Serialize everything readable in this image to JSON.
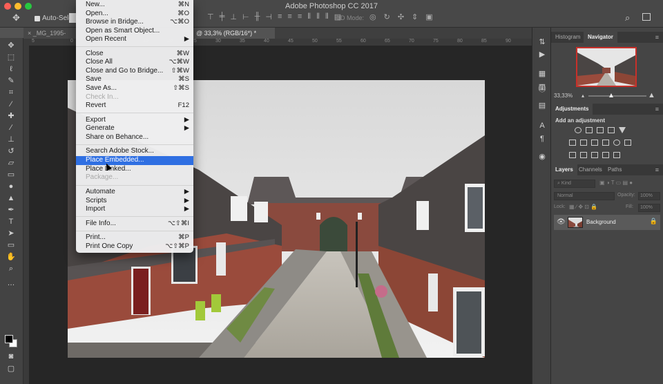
{
  "window": {
    "title": "Adobe Photoshop CC 2017"
  },
  "options_bar": {
    "auto_select_label": "Auto-Select:",
    "mode3d_label": "3D Mode:"
  },
  "doc_tabs": [
    {
      "label": "_MG_1995-bewe"
    },
    {
      "label": "@ 33,3% (RGB/16*) *"
    }
  ],
  "ruler_ticks": [
    "5",
    "0",
    "5",
    "10",
    "15",
    "20",
    "25",
    "30",
    "35",
    "40",
    "45",
    "50",
    "55",
    "60",
    "65",
    "70",
    "75",
    "80",
    "85",
    "90"
  ],
  "file_menu": {
    "items": [
      {
        "label": "New...",
        "shortcut": "⌘N",
        "state": "normal"
      },
      {
        "label": "Open...",
        "shortcut": "⌘O",
        "state": "normal"
      },
      {
        "label": "Browse in Bridge...",
        "shortcut": "⌥⌘O",
        "state": "normal"
      },
      {
        "label": "Open as Smart Object...",
        "shortcut": "",
        "state": "normal"
      },
      {
        "label": "Open Recent",
        "shortcut": "▶",
        "state": "normal"
      },
      {
        "label": "Close",
        "shortcut": "⌘W",
        "state": "normal"
      },
      {
        "label": "Close All",
        "shortcut": "⌥⌘W",
        "state": "normal"
      },
      {
        "label": "Close and Go to Bridge...",
        "shortcut": "⇧⌘W",
        "state": "normal"
      },
      {
        "label": "Save",
        "shortcut": "⌘S",
        "state": "normal"
      },
      {
        "label": "Save As...",
        "shortcut": "⇧⌘S",
        "state": "normal"
      },
      {
        "label": "Check In...",
        "shortcut": "",
        "state": "disabled"
      },
      {
        "label": "Revert",
        "shortcut": "F12",
        "state": "normal"
      },
      {
        "label": "Export",
        "shortcut": "▶",
        "state": "normal"
      },
      {
        "label": "Generate",
        "shortcut": "▶",
        "state": "normal"
      },
      {
        "label": "Share on Behance...",
        "shortcut": "",
        "state": "normal"
      },
      {
        "label": "Search Adobe Stock...",
        "shortcut": "",
        "state": "normal"
      },
      {
        "label": "Place Embedded...",
        "shortcut": "",
        "state": "highlighted"
      },
      {
        "label": "Place Linked...",
        "shortcut": "",
        "state": "normal"
      },
      {
        "label": "Package...",
        "shortcut": "",
        "state": "disabled"
      },
      {
        "label": "Automate",
        "shortcut": "▶",
        "state": "normal"
      },
      {
        "label": "Scripts",
        "shortcut": "▶",
        "state": "normal"
      },
      {
        "label": "Import",
        "shortcut": "▶",
        "state": "normal"
      },
      {
        "label": "File Info...",
        "shortcut": "⌥⇧⌘I",
        "state": "normal"
      },
      {
        "label": "Print...",
        "shortcut": "⌘P",
        "state": "normal"
      },
      {
        "label": "Print One Copy",
        "shortcut": "⌥⇧⌘P",
        "state": "normal"
      }
    ]
  },
  "panels": {
    "histogram_tab": "Histogram",
    "navigator_tab": "Navigator",
    "zoom_value": "33,33%",
    "adjustments_tab": "Adjustments",
    "adjustments_subtitle": "Add an adjustment",
    "layers_tab": "Layers",
    "channels_tab": "Channels",
    "paths_tab": "Paths",
    "kind_label": "Kind",
    "blend_mode": "Normal",
    "opacity_label": "Opacity:",
    "opacity_value": "100%",
    "lock_label": "Lock:",
    "fill_label": "Fill:",
    "fill_value": "100%",
    "layer_name": "Background"
  },
  "colors": {
    "menu_highlight": "#2f6fe2",
    "nav_frame": "#c8302a"
  }
}
